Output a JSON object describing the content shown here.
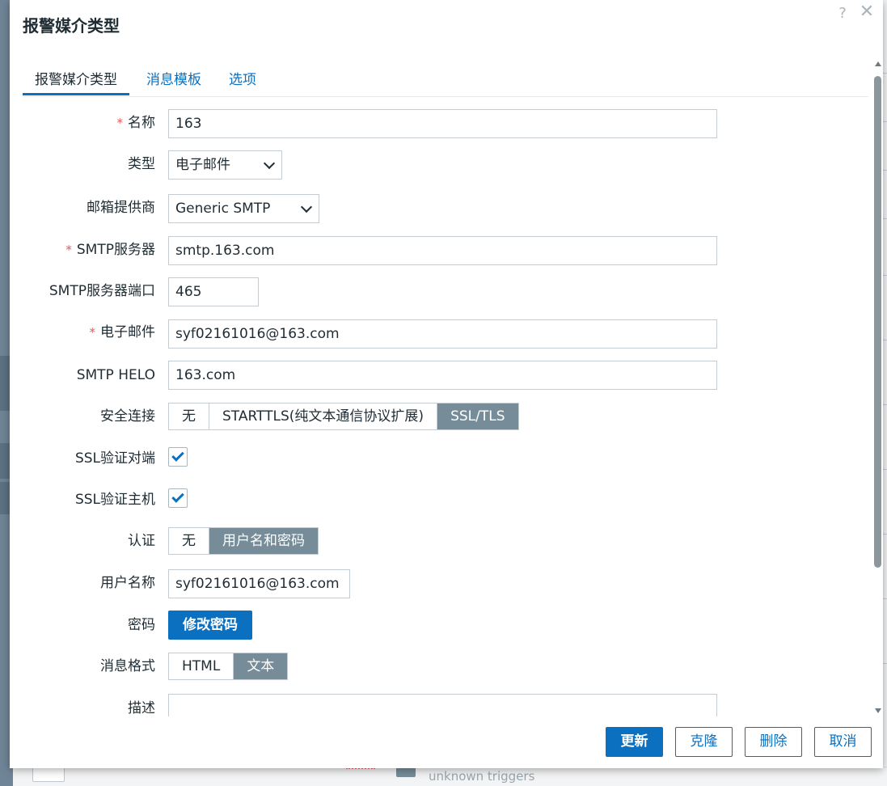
{
  "dialog": {
    "title": "报警媒介类型",
    "help_icon": "question-mark-icon",
    "close_icon": "close-icon"
  },
  "tabs": [
    {
      "label": "报警媒介类型",
      "active": true
    },
    {
      "label": "消息模板",
      "active": false
    },
    {
      "label": "选项",
      "active": false
    }
  ],
  "form": {
    "name": {
      "label": "名称",
      "required": true,
      "value": "163"
    },
    "type": {
      "label": "类型",
      "value": "电子邮件"
    },
    "provider": {
      "label": "邮箱提供商",
      "value": "Generic SMTP"
    },
    "smtp_server": {
      "label": "SMTP服务器",
      "required": true,
      "value": "smtp.163.com"
    },
    "smtp_port": {
      "label": "SMTP服务器端口",
      "value": "465"
    },
    "email": {
      "label": "电子邮件",
      "required": true,
      "value": "syf02161016@163.com"
    },
    "smtp_helo": {
      "label": "SMTP HELO",
      "value": "163.com"
    },
    "security": {
      "label": "安全连接",
      "options": [
        "无",
        "STARTTLS(纯文本通信协议扩展)",
        "SSL/TLS"
      ],
      "selected": "SSL/TLS"
    },
    "ssl_verify_peer": {
      "label": "SSL验证对端",
      "checked": true
    },
    "ssl_verify_host": {
      "label": "SSL验证主机",
      "checked": true
    },
    "auth": {
      "label": "认证",
      "options": [
        "无",
        "用户名和密码"
      ],
      "selected": "用户名和密码"
    },
    "username": {
      "label": "用户名称",
      "value": "syf02161016@163.com"
    },
    "password": {
      "label": "密码",
      "button_label": "修改密码"
    },
    "message_format": {
      "label": "消息格式",
      "options": [
        "HTML",
        "文本"
      ],
      "selected": "文本"
    },
    "description": {
      "label": "描述",
      "value": ""
    }
  },
  "footer": {
    "update_label": "更新",
    "clone_label": "克隆",
    "delete_label": "删除",
    "cancel_label": "取消"
  },
  "background": {
    "faded_text": "unknown triggers"
  },
  "colors": {
    "accent": "#0b70c0",
    "segment_selected": "#768d99",
    "required": "#e45959"
  }
}
